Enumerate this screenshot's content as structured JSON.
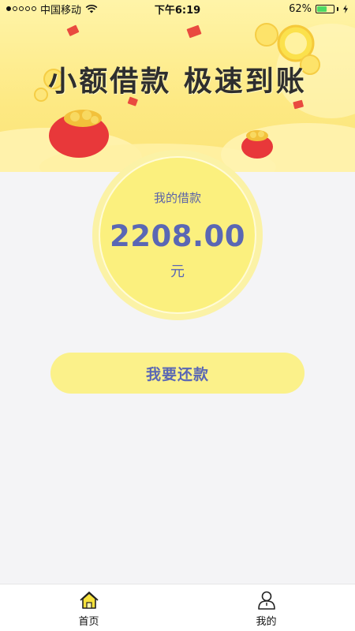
{
  "status_bar": {
    "carrier": "中国移动",
    "time": "下午6:19",
    "battery_percent": "62%",
    "battery_level": 0.62
  },
  "banner": {
    "title": "小额借款  极速到账"
  },
  "loan": {
    "label": "我的借款",
    "amount": "2208.00",
    "unit": "元"
  },
  "actions": {
    "repay_label": "我要还款"
  },
  "tabbar": {
    "items": [
      {
        "label": "首页",
        "icon": "home-icon",
        "active": true
      },
      {
        "label": "我的",
        "icon": "profile-icon",
        "active": false
      }
    ]
  },
  "colors": {
    "accent_text": "#5a67b4",
    "circle_fill": "#fbf07e",
    "button_fill": "#fbf18a",
    "banner_yellow": "#fde983"
  }
}
